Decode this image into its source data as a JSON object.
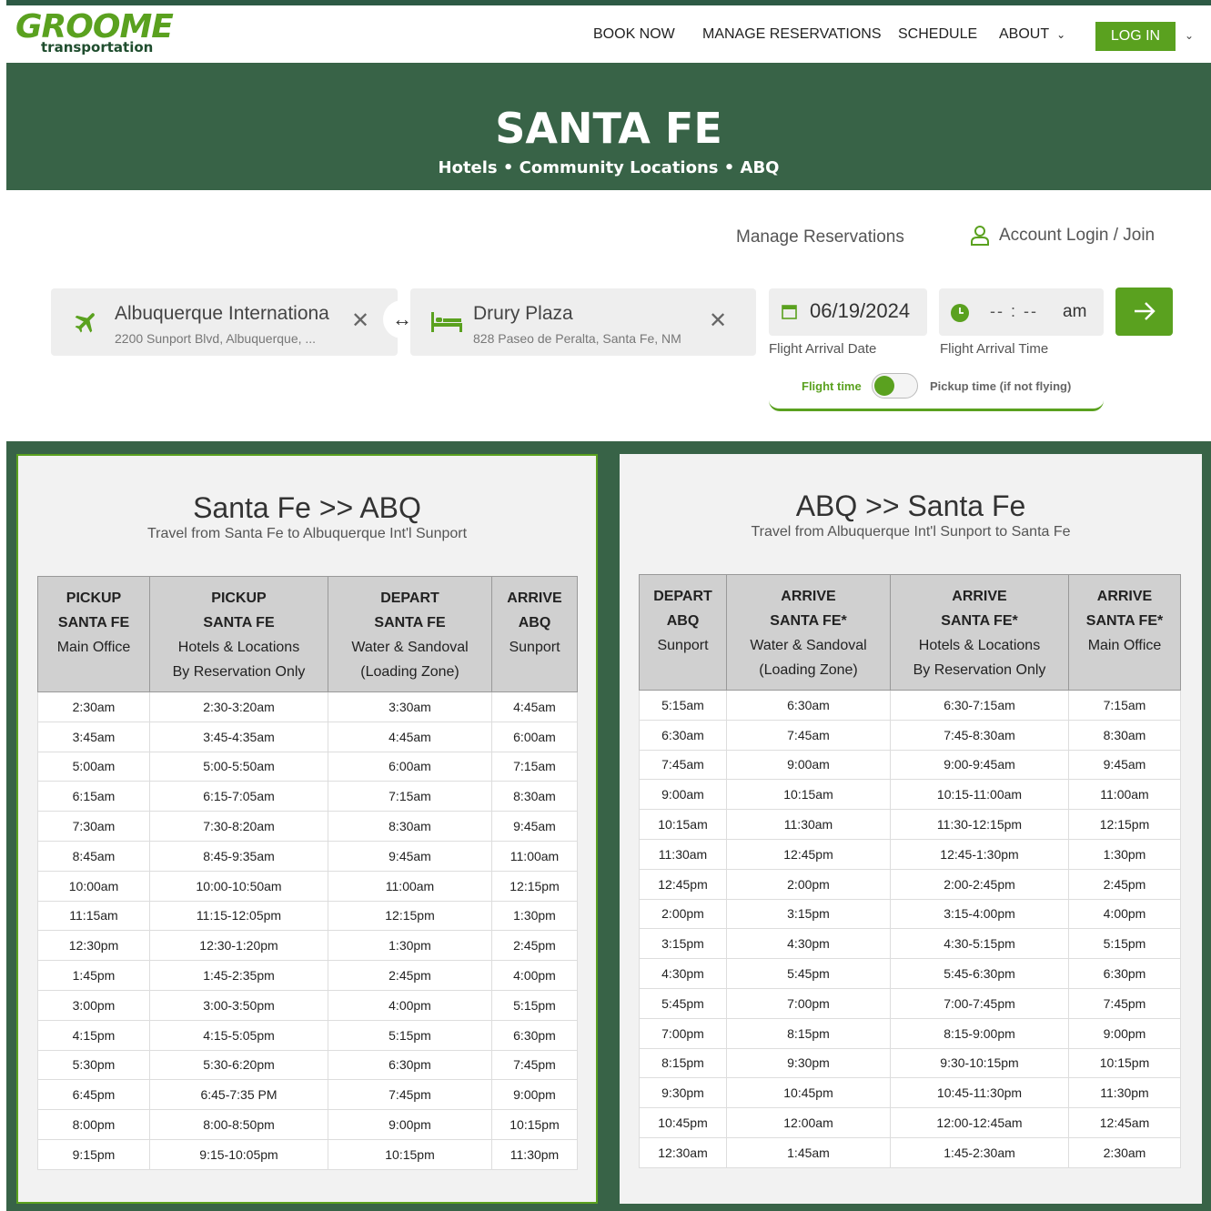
{
  "brand": {
    "name": "GROOME",
    "sub": "transportation"
  },
  "nav": {
    "book_now": "BOOK NOW",
    "manage": "MANAGE RESERVATIONS",
    "schedule": "SCHEDULE",
    "about": "ABOUT",
    "login": "LOG IN"
  },
  "hero": {
    "title": "SANTA FE",
    "subtitle": "Hotels • Community Locations • ABQ"
  },
  "links": {
    "manage": "Manage Reservations",
    "account": "Account Login / Join"
  },
  "booking": {
    "origin": {
      "name": "Albuquerque Internationa",
      "address": "2200 Sunport Blvd, Albuquerque, ..."
    },
    "destination": {
      "name": "Drury Plaza",
      "address": "828 Paseo de Peralta, Santa Fe, NM"
    },
    "date_value": "06/19/2024",
    "date_label": "Flight Arrival Date",
    "time_value": "-- : --",
    "time_ampm": "am",
    "time_label": "Flight Arrival Time",
    "toggle_left": "Flight time",
    "toggle_right": "Pickup time (if not flying)"
  },
  "icons": {
    "plane": "plane-icon",
    "bed": "bed-icon",
    "calendar": "calendar-icon",
    "clock": "clock-icon",
    "user": "user-icon",
    "arrow": "arrow-right-icon",
    "swap": "swap-icon",
    "close": "close-icon"
  },
  "colors": {
    "brand_green": "#5aa11f",
    "dark_green": "#386347",
    "header_row": "#d0d0d0"
  },
  "schedules": [
    {
      "title": "Santa Fe >> ABQ",
      "subtitle": "Travel from Santa Fe to Albuquerque Int'l Sunport",
      "columns": [
        {
          "l1": "PICKUP",
          "l2": "SANTA FE",
          "l3": "Main Office",
          "l4": ""
        },
        {
          "l1": "PICKUP",
          "l2": "SANTA FE",
          "l3": "Hotels & Locations",
          "l4": "By Reservation Only"
        },
        {
          "l1": "DEPART",
          "l2": "SANTA FE",
          "l3": "Water & Sandoval",
          "l4": "(Loading Zone)"
        },
        {
          "l1": "ARRIVE",
          "l2": "ABQ",
          "l3": "Sunport",
          "l4": ""
        }
      ],
      "rows": [
        [
          "2:30am",
          "2:30-3:20am",
          "3:30am",
          "4:45am"
        ],
        [
          "3:45am",
          "3:45-4:35am",
          "4:45am",
          "6:00am"
        ],
        [
          "5:00am",
          "5:00-5:50am",
          "6:00am",
          "7:15am"
        ],
        [
          "6:15am",
          "6:15-7:05am",
          "7:15am",
          "8:30am"
        ],
        [
          "7:30am",
          "7:30-8:20am",
          "8:30am",
          "9:45am"
        ],
        [
          "8:45am",
          "8:45-9:35am",
          "9:45am",
          "11:00am"
        ],
        [
          "10:00am",
          "10:00-10:50am",
          "11:00am",
          "12:15pm"
        ],
        [
          "11:15am",
          "11:15-12:05pm",
          "12:15pm",
          "1:30pm"
        ],
        [
          "12:30pm",
          "12:30-1:20pm",
          "1:30pm",
          "2:45pm"
        ],
        [
          "1:45pm",
          "1:45-2:35pm",
          "2:45pm",
          "4:00pm"
        ],
        [
          "3:00pm",
          "3:00-3:50pm",
          "4:00pm",
          "5:15pm"
        ],
        [
          "4:15pm",
          "4:15-5:05pm",
          "5:15pm",
          "6:30pm"
        ],
        [
          "5:30pm",
          "5:30-6:20pm",
          "6:30pm",
          "7:45pm"
        ],
        [
          "6:45pm",
          "6:45-7:35 PM",
          "7:45pm",
          "9:00pm"
        ],
        [
          "8:00pm",
          "8:00-8:50pm",
          "9:00pm",
          "10:15pm"
        ],
        [
          "9:15pm",
          "9:15-10:05pm",
          "10:15pm",
          "11:30pm"
        ]
      ]
    },
    {
      "title": "ABQ >> Santa Fe",
      "subtitle": "Travel from Albuquerque Int'l Sunport to Santa Fe",
      "columns": [
        {
          "l1": "DEPART",
          "l2": "ABQ",
          "l3": "Sunport",
          "l4": ""
        },
        {
          "l1": "ARRIVE",
          "l2": "SANTA FE*",
          "l3": "Water & Sandoval",
          "l4": "(Loading Zone)"
        },
        {
          "l1": "ARRIVE",
          "l2": "SANTA FE*",
          "l3": "Hotels & Locations",
          "l4": "By Reservation Only"
        },
        {
          "l1": "ARRIVE",
          "l2": "SANTA FE*",
          "l3": "Main Office",
          "l4": ""
        }
      ],
      "rows": [
        [
          "5:15am",
          "6:30am",
          "6:30-7:15am",
          "7:15am"
        ],
        [
          "6:30am",
          "7:45am",
          "7:45-8:30am",
          "8:30am"
        ],
        [
          "7:45am",
          "9:00am",
          "9:00-9:45am",
          "9:45am"
        ],
        [
          "9:00am",
          "10:15am",
          "10:15-11:00am",
          "11:00am"
        ],
        [
          "10:15am",
          "11:30am",
          "11:30-12:15pm",
          "12:15pm"
        ],
        [
          "11:30am",
          "12:45pm",
          "12:45-1:30pm",
          "1:30pm"
        ],
        [
          "12:45pm",
          "2:00pm",
          "2:00-2:45pm",
          "2:45pm"
        ],
        [
          "2:00pm",
          "3:15pm",
          "3:15-4:00pm",
          "4:00pm"
        ],
        [
          "3:15pm",
          "4:30pm",
          "4:30-5:15pm",
          "5:15pm"
        ],
        [
          "4:30pm",
          "5:45pm",
          "5:45-6:30pm",
          "6:30pm"
        ],
        [
          "5:45pm",
          "7:00pm",
          "7:00-7:45pm",
          "7:45pm"
        ],
        [
          "7:00pm",
          "8:15pm",
          "8:15-9:00pm",
          "9:00pm"
        ],
        [
          "8:15pm",
          "9:30pm",
          "9:30-10:15pm",
          "10:15pm"
        ],
        [
          "9:30pm",
          "10:45pm",
          "10:45-11:30pm",
          "11:30pm"
        ],
        [
          "10:45pm",
          "12:00am",
          "12:00-12:45am",
          "12:45am"
        ],
        [
          "12:30am",
          "1:45am",
          "1:45-2:30am",
          "2:30am"
        ]
      ]
    }
  ]
}
